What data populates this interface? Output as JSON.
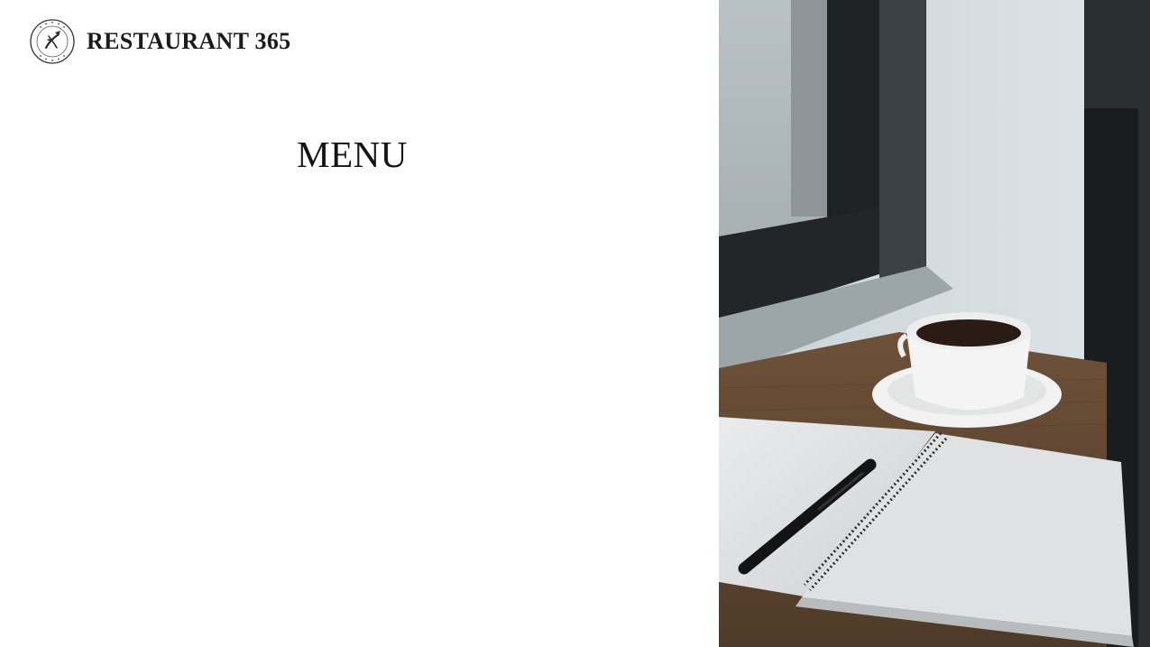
{
  "brand": {
    "name": "RESTAURANT 365",
    "logo_icon": "restaurant-seal-icon",
    "seal_text_top": "RESTAURANT 365",
    "seal_text_bottom": "METAMORPHOSES"
  },
  "main": {
    "title": "MENU"
  },
  "hero_image": {
    "icon": "coffee-notebook-photo"
  },
  "colors": {
    "background": "#ffffff",
    "text": "#141414"
  }
}
